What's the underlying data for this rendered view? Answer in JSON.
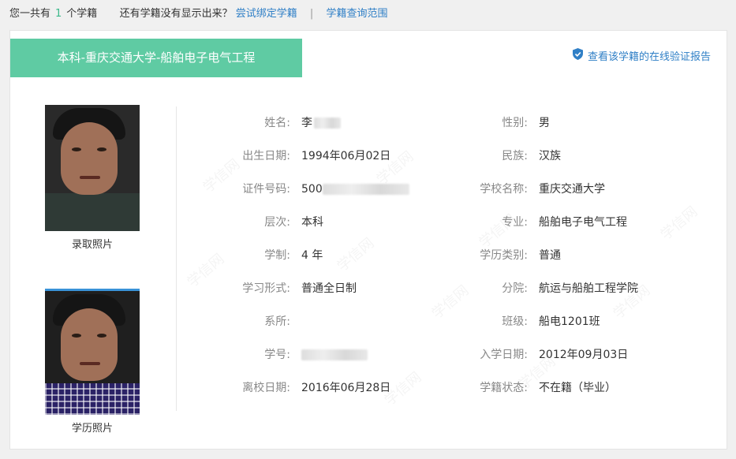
{
  "topbar": {
    "prefix": "您一共有",
    "count": "1",
    "suffix": "个学籍",
    "question": "还有学籍没有显示出来？",
    "bind_link": "尝试绑定学籍",
    "separator": "|",
    "scope_link": "学籍查询范围"
  },
  "card": {
    "tab_title": "本科-重庆交通大学-船舶电子电气工程",
    "verify_link": "查看该学籍的在线验证报告",
    "watermark": "学信网"
  },
  "photos": {
    "admission_caption": "录取照片",
    "degree_caption": "学历照片"
  },
  "left_fields": [
    {
      "label": "姓名:",
      "value": "李"
    },
    {
      "label": "出生日期:",
      "value": "1994年06月02日"
    },
    {
      "label": "证件号码:",
      "value": "500"
    },
    {
      "label": "层次:",
      "value": "本科"
    },
    {
      "label": "学制:",
      "value": "4 年"
    },
    {
      "label": "学习形式:",
      "value": "普通全日制"
    },
    {
      "label": "系所:",
      "value": ""
    },
    {
      "label": "学号:",
      "value": ""
    },
    {
      "label": "离校日期:",
      "value": "2016年06月28日"
    }
  ],
  "right_fields": [
    {
      "label": "性别:",
      "value": "男"
    },
    {
      "label": "民族:",
      "value": "汉族"
    },
    {
      "label": "学校名称:",
      "value": "重庆交通大学"
    },
    {
      "label": "专业:",
      "value": "船舶电子电气工程"
    },
    {
      "label": "学历类别:",
      "value": "普通"
    },
    {
      "label": "分院:",
      "value": "航运与船舶工程学院"
    },
    {
      "label": "班级:",
      "value": "船电1201班"
    },
    {
      "label": "入学日期:",
      "value": "2012年09月03日"
    },
    {
      "label": "学籍状态:",
      "value": "不在籍（毕业）"
    }
  ],
  "colors": {
    "accent": "#5fcba3",
    "link": "#2f7fc6",
    "count": "#3ab88a"
  }
}
